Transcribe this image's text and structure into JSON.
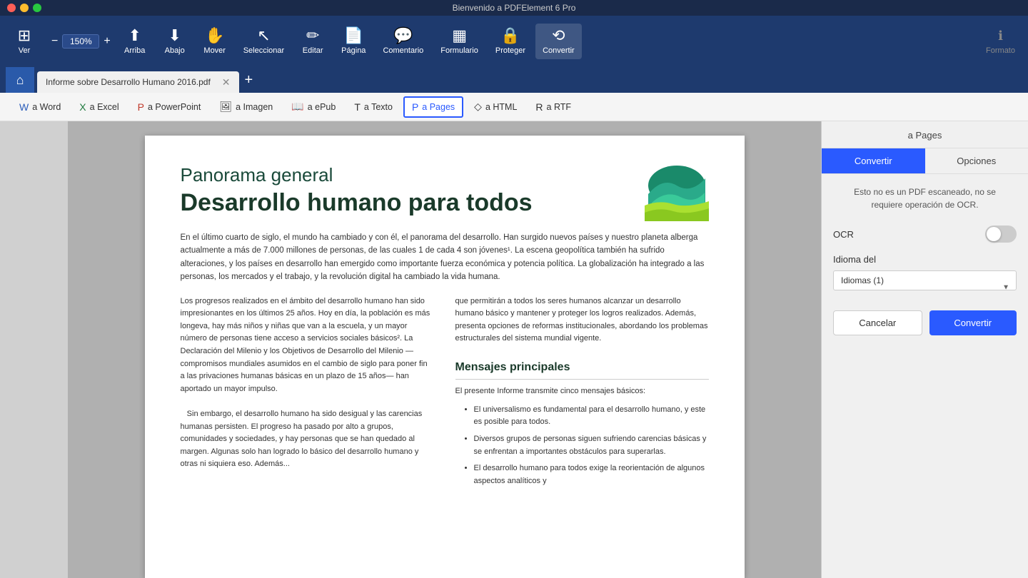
{
  "app": {
    "title": "Bienvenido a PDFElement 6 Pro",
    "window_title": "Informe sobre Desarrollo Humano 2016.pdf"
  },
  "traffic_lights": {
    "red": "close",
    "yellow": "minimize",
    "green": "maximize"
  },
  "toolbar": {
    "zoom_value": "150%",
    "items": [
      {
        "id": "ver",
        "label": "Ver",
        "icon": "⊞"
      },
      {
        "id": "arriba",
        "label": "Arriba",
        "icon": "⬆"
      },
      {
        "id": "abajo",
        "label": "Abajo",
        "icon": "⬇"
      },
      {
        "id": "mover",
        "label": "Mover",
        "icon": "✋"
      },
      {
        "id": "seleccionar",
        "label": "Seleccionar",
        "icon": "↖"
      },
      {
        "id": "editar",
        "label": "Editar",
        "icon": "✏"
      },
      {
        "id": "pagina",
        "label": "Página",
        "icon": "📄"
      },
      {
        "id": "comentario",
        "label": "Comentario",
        "icon": "💬"
      },
      {
        "id": "formulario",
        "label": "Formulario",
        "icon": "▦"
      },
      {
        "id": "proteger",
        "label": "Proteger",
        "icon": "🔒"
      },
      {
        "id": "convertir",
        "label": "Convertir",
        "icon": "⟲"
      }
    ],
    "format_label": "Formato"
  },
  "tab": {
    "document_name": "Informe sobre Desarrollo Humano 2016.pdf"
  },
  "convert_tabs": [
    {
      "id": "word",
      "label": "a Word",
      "icon": "W",
      "active": false
    },
    {
      "id": "excel",
      "label": "a Excel",
      "icon": "X",
      "active": false
    },
    {
      "id": "powerpoint",
      "label": "a PowerPoint",
      "icon": "P",
      "active": false
    },
    {
      "id": "imagen",
      "label": "a Imagen",
      "icon": "🖼",
      "active": false
    },
    {
      "id": "epub",
      "label": "a ePub",
      "icon": "📖",
      "active": false
    },
    {
      "id": "texto",
      "label": "a Texto",
      "icon": "T",
      "active": false
    },
    {
      "id": "pages",
      "label": "a Pages",
      "icon": "P",
      "active": true
    },
    {
      "id": "html",
      "label": "a HTML",
      "icon": "◇",
      "active": false
    },
    {
      "id": "rtf",
      "label": "a RTF",
      "icon": "R",
      "active": false
    }
  ],
  "pdf_content": {
    "title_normal": "Panorama general",
    "title_bold": "Desarrollo humano para todos",
    "body_paragraph": "En el último cuarto de siglo, el mundo ha cambiado y con él, el panorama del desarrollo. Han surgido nuevos países y nuestro planeta alberga actualmente a más de 7.000 millones de personas, de las cuales 1 de cada 4 son jóvenes¹. La escena geopolítica también ha sufrido alteraciones, y los países en desarrollo han emergido como importante fuerza económica y potencia política. La globalización ha integrado a las personas, los mercados y el trabajo, y la revolución digital ha cambiado la vida humana.",
    "left_col_text": "Los progresos realizados en el ámbito del desarrollo humano han sido impresionantes en los últimos 25 años. Hoy en día, la población es más longeva, hay más niños y niñas que van a la escuela, y un mayor número de personas tiene acceso a servicios sociales básicos². La Declaración del Milenio y los Objetivos de Desarrollo del Milenio —compromisos mundiales asumidos en el cambio de siglo para poner fin a las privaciones humanas básicas en un plazo de 15 años— han aportado un mayor impulso.\n    Sin embargo, el desarrollo humano ha sido desigual y las carencias humanas persisten. El progreso ha pasado por alto a grupos, comunidades y sociedades, y hay personas que se han quedado al margen. Algunas solo han logrado lo básico del desarrollo humano y otras ni siquiera eso. Adem...",
    "right_col_text": "que permitirán a todos los seres humanos alcanzar un desarrollo humano básico y mantener y proteger los logros realizados. Además, presenta opciones de reformas institucionales, abordando los problemas estructurales del sistema mundial vigente.",
    "messages_heading": "Mensajes principales",
    "messages_intro": "El presente Informe transmite cinco mensajes básicos:",
    "bullets": [
      "El universalismo es fundamental para el desarrollo humano, y este es posible para todos.",
      "Diversos grupos de personas siguen sufriendo carencias básicas y se enfrentan a importantes obstáculos para superarlas.",
      "El desarrollo humano para todos exige la reorientación de algunos aspectos analíticos y"
    ]
  },
  "right_panel": {
    "title": "a Pages",
    "tab_convert": "Convertir",
    "tab_options": "Opciones",
    "notice": "Esto no es un PDF escaneado, no se requiere operación de OCR.",
    "ocr_label": "OCR",
    "ocr_enabled": false,
    "idioma_label": "Idioma del",
    "idioma_placeholder": "Idiomas (1)",
    "cancel_label": "Cancelar",
    "convert_label": "Convertir"
  }
}
